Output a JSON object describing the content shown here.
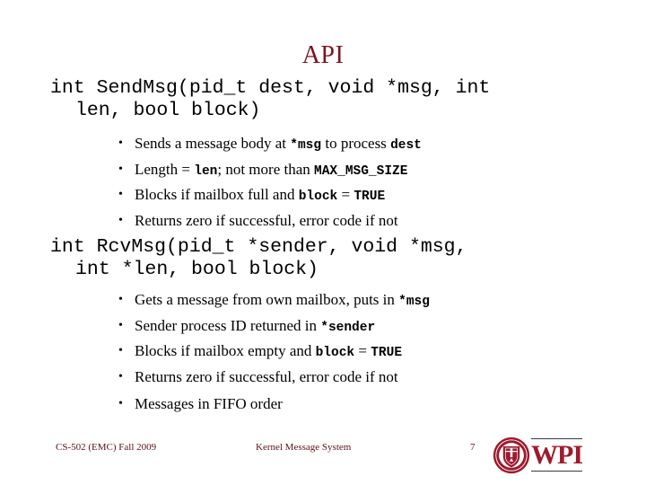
{
  "slide": {
    "title": "API",
    "page_number": "7"
  },
  "send_msg": {
    "signature_line1": "int SendMsg(pid_t dest, void *msg, int",
    "signature_line2": "len, bool block)",
    "bullets": [
      [
        {
          "text": "Sends a message body at ",
          "style": "normal"
        },
        {
          "text": "*msg",
          "style": "mono"
        },
        {
          "text": " to process ",
          "style": "normal"
        },
        {
          "text": "dest",
          "style": "mono"
        }
      ],
      [
        {
          "text": "Length = ",
          "style": "normal"
        },
        {
          "text": "len",
          "style": "mono"
        },
        {
          "text": "; not more than ",
          "style": "normal"
        },
        {
          "text": "MAX_MSG_SIZE",
          "style": "mono"
        }
      ],
      [
        {
          "text": "Blocks if mailbox full and ",
          "style": "normal"
        },
        {
          "text": "block",
          "style": "mono"
        },
        {
          "text": " = ",
          "style": "normal"
        },
        {
          "text": "TRUE",
          "style": "mono"
        }
      ],
      [
        {
          "text": "Returns zero if successful, error code if not",
          "style": "normal"
        }
      ]
    ]
  },
  "rcv_msg": {
    "signature_line1": "int RcvMsg(pid_t *sender, void *msg,",
    "signature_line2": "int *len, bool block)",
    "bullets": [
      [
        {
          "text": "Gets a message from own mailbox, puts in ",
          "style": "normal"
        },
        {
          "text": "*msg",
          "style": "mono"
        }
      ],
      [
        {
          "text": "Sender process ID returned in  ",
          "style": "normal"
        },
        {
          "text": "*sender",
          "style": "mono"
        }
      ],
      [
        {
          "text": "Blocks if mailbox empty and ",
          "style": "normal"
        },
        {
          "text": "block",
          "style": "mono"
        },
        {
          "text": " = ",
          "style": "normal"
        },
        {
          "text": "TRUE",
          "style": "mono"
        }
      ],
      [
        {
          "text": "Returns zero if successful, error code if not",
          "style": "normal"
        }
      ]
    ]
  },
  "fifo": {
    "bullets": [
      [
        {
          "text": "Messages in FIFO order",
          "style": "normal"
        }
      ]
    ]
  },
  "footer": {
    "left": "CS-502 (EMC) Fall 2009",
    "center": "Kernel Message System",
    "page": "7"
  },
  "logo": {
    "wordmark": "WPI",
    "seal_name": "wpi-seal-icon",
    "crimson": "#9C1B2E",
    "title_color": "#7B1520"
  }
}
